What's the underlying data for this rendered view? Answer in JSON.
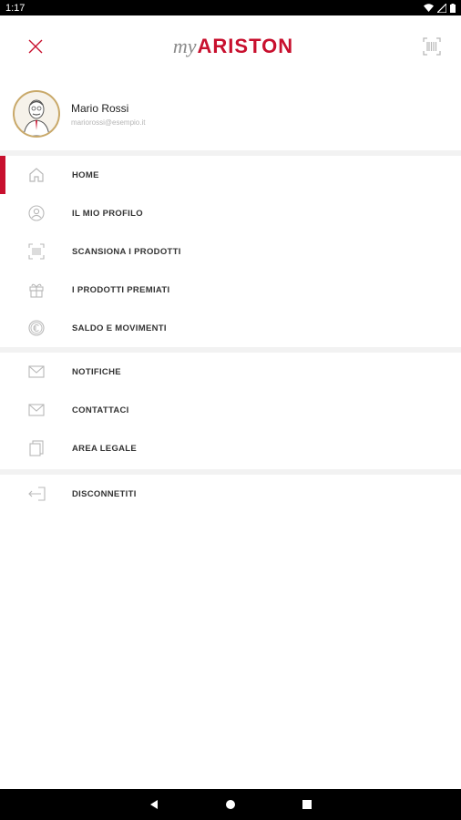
{
  "status_bar": {
    "time": "1:17"
  },
  "header": {
    "logo_my": "my",
    "logo_brand": "ARISTON"
  },
  "profile": {
    "name": "Mario Rossi",
    "email": "mariorossi@esempio.it"
  },
  "menu_primary": [
    {
      "label": "HOME",
      "icon": "home-icon",
      "active": true
    },
    {
      "label": "IL MIO PROFILO",
      "icon": "user-icon"
    },
    {
      "label": "SCANSIONA I PRODOTTI",
      "icon": "scan-icon"
    },
    {
      "label": "I PRODOTTI PREMIATI",
      "icon": "gift-icon"
    },
    {
      "label": "SALDO E MOVIMENTI",
      "icon": "coin-icon"
    }
  ],
  "menu_secondary": [
    {
      "label": "NOTIFICHE",
      "icon": "mail-icon"
    },
    {
      "label": "CONTATTACI",
      "icon": "mail-icon"
    },
    {
      "label": "AREA LEGALE",
      "icon": "document-icon"
    }
  ],
  "menu_logout": [
    {
      "label": "DISCONNETITI",
      "icon": "logout-icon"
    }
  ],
  "colors": {
    "accent": "#c8102e",
    "avatar_ring": "#c9a96a",
    "icon_gray": "#b8b8b8"
  }
}
